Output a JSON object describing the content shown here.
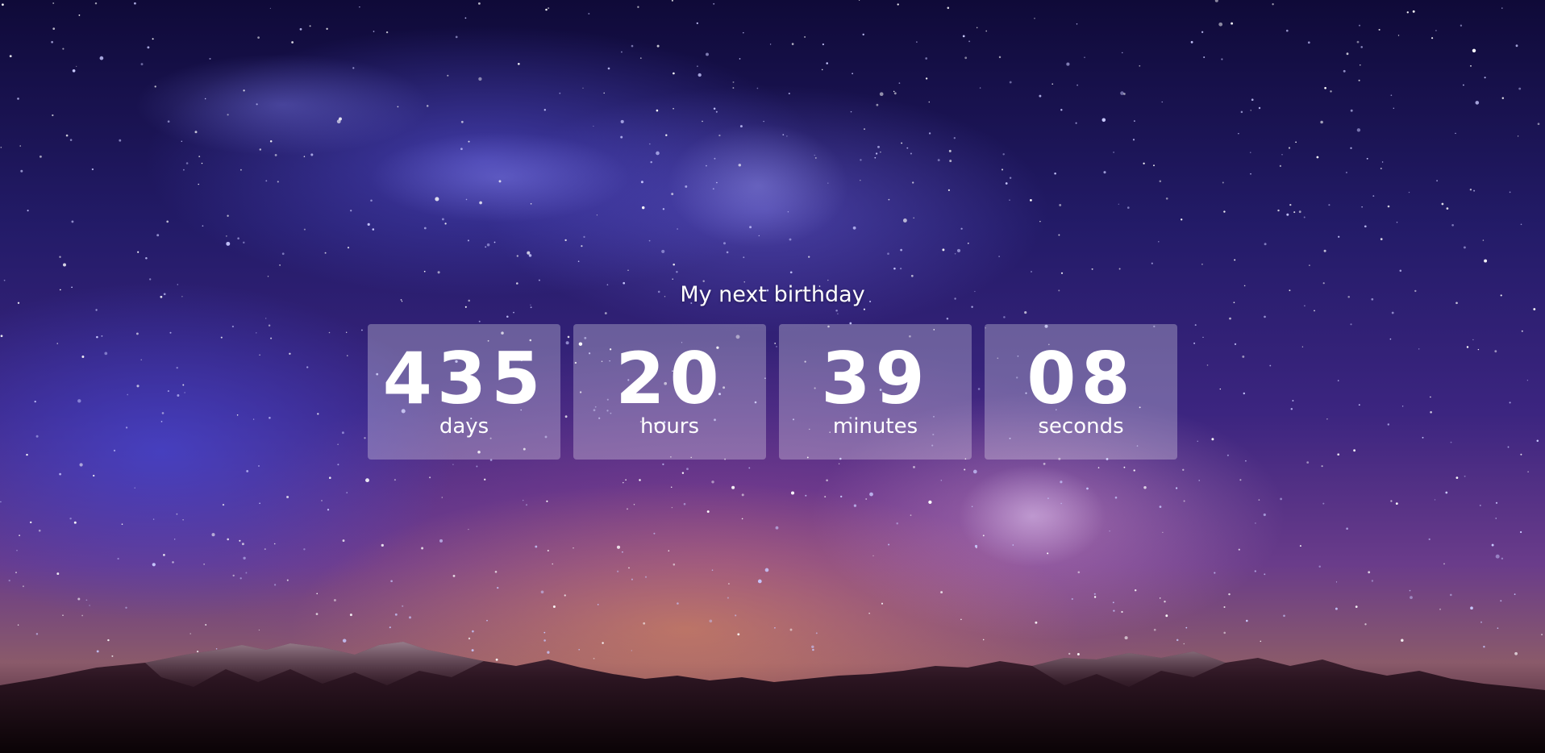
{
  "countdown": {
    "title": "My next birthday",
    "units": [
      {
        "value": "435",
        "label": "days"
      },
      {
        "value": "20",
        "label": "hours"
      },
      {
        "value": "39",
        "label": "minutes"
      },
      {
        "value": "08",
        "label": "seconds"
      }
    ]
  }
}
